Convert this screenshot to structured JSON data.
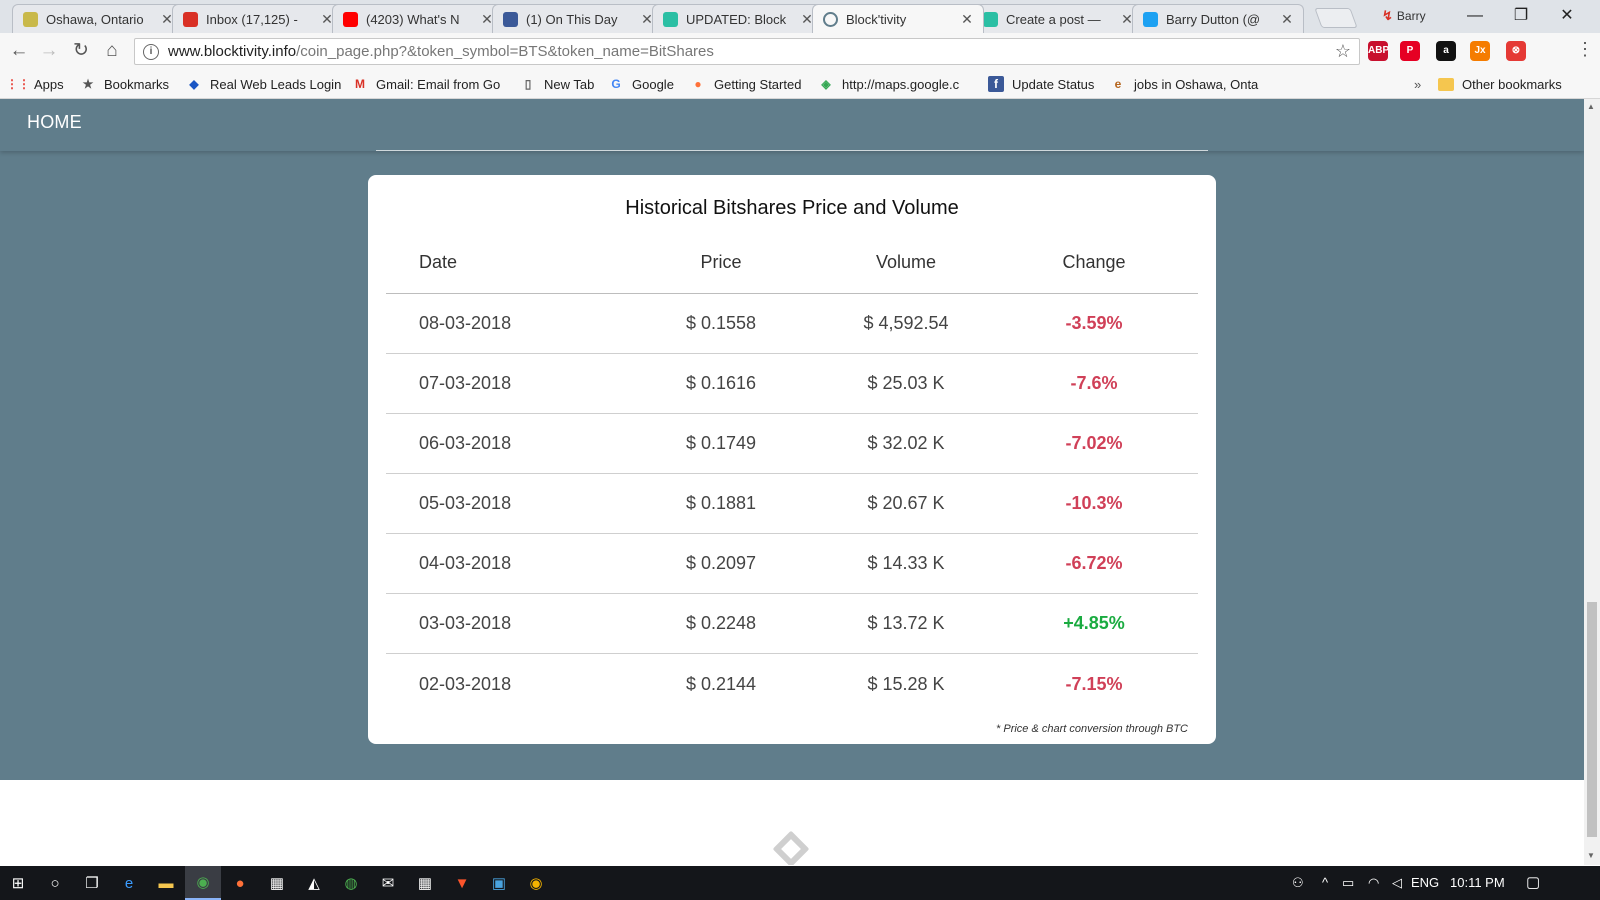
{
  "tabs": [
    {
      "title": "Oshawa, Ontario",
      "icon": "weather-icon",
      "color": "#c9b94a",
      "active": false
    },
    {
      "title": "Inbox (17,125) -",
      "icon": "gmail-icon",
      "color": "#d93025",
      "active": false
    },
    {
      "title": "(4203) What's N",
      "icon": "youtube-icon",
      "color": "#ff0000",
      "active": false
    },
    {
      "title": "(1) On This Day",
      "icon": "facebook-icon",
      "color": "#3b5998",
      "active": false
    },
    {
      "title": "UPDATED: Block",
      "icon": "blocktivity-icon",
      "color": "#2bbfa4",
      "active": false
    },
    {
      "title": "Block'tivity",
      "icon": "loading-icon",
      "color": "#607d8b",
      "active": true
    },
    {
      "title": "Create a post —",
      "icon": "blocktivity-icon",
      "color": "#2bbfa4",
      "active": false
    },
    {
      "title": "Barry Dutton (@",
      "icon": "twitter-icon",
      "color": "#1da1f2",
      "active": false
    }
  ],
  "profile_name": "Barry",
  "address": {
    "host": "www.blocktivity.info",
    "path": "/coin_page.php?&token_symbol=BTS&token_name=BitShares"
  },
  "extensions": [
    {
      "name": "adblock-icon",
      "label": "ABP",
      "badge": "1",
      "color": "#c8102e"
    },
    {
      "name": "pinterest-icon",
      "label": "P",
      "badge": "",
      "color": "#e60023"
    },
    {
      "name": "amazon-icon",
      "label": "a",
      "badge": "5",
      "color": "#111111"
    },
    {
      "name": "jx-icon",
      "label": "Jx",
      "badge": "",
      "color": "#f57c00"
    },
    {
      "name": "close-circle-icon",
      "label": "⊗",
      "badge": "",
      "color": "#e53935"
    }
  ],
  "bookmarks": [
    {
      "label": "Apps",
      "icon": "apps-grid-icon"
    },
    {
      "label": "Bookmarks",
      "icon": "star-icon"
    },
    {
      "label": "Real Web Leads Login",
      "icon": "leads-icon"
    },
    {
      "label": "Gmail: Email from Go",
      "icon": "gmail-icon"
    },
    {
      "label": "New Tab",
      "icon": "page-icon"
    },
    {
      "label": "Google",
      "icon": "google-icon"
    },
    {
      "label": "Getting Started",
      "icon": "firefox-icon"
    },
    {
      "label": "http://maps.google.c",
      "icon": "maps-icon"
    },
    {
      "label": "Update Status",
      "icon": "facebook-icon"
    },
    {
      "label": "jobs in Oshawa, Onta",
      "icon": "eluta-icon"
    }
  ],
  "overflow_label": "»",
  "other_bookmarks": "Other bookmarks",
  "nav": {
    "home": "HOME"
  },
  "table": {
    "title": "Historical Bitshares Price and Volume",
    "headers": [
      "Date",
      "Price",
      "Volume",
      "Change"
    ],
    "rows": [
      {
        "date": "08-03-2018",
        "price": "$ 0.1558",
        "volume": "$ 4,592.54",
        "change": "-3.59%",
        "trend": "neg"
      },
      {
        "date": "07-03-2018",
        "price": "$ 0.1616",
        "volume": "$ 25.03 K",
        "change": "-7.6%",
        "trend": "neg"
      },
      {
        "date": "06-03-2018",
        "price": "$ 0.1749",
        "volume": "$ 32.02 K",
        "change": "-7.02%",
        "trend": "neg"
      },
      {
        "date": "05-03-2018",
        "price": "$ 0.1881",
        "volume": "$ 20.67 K",
        "change": "-10.3%",
        "trend": "neg"
      },
      {
        "date": "04-03-2018",
        "price": "$ 0.2097",
        "volume": "$ 14.33 K",
        "change": "-6.72%",
        "trend": "neg"
      },
      {
        "date": "03-03-2018",
        "price": "$ 0.2248",
        "volume": "$ 13.72 K",
        "change": "+4.85%",
        "trend": "pos"
      },
      {
        "date": "02-03-2018",
        "price": "$ 0.2144",
        "volume": "$ 15.28 K",
        "change": "-7.15%",
        "trend": "neg"
      }
    ],
    "footnote": "* Price & chart conversion through BTC"
  },
  "colors": {
    "page_bg": "#607d8b",
    "negative": "#d04058",
    "positive": "#1aab40"
  },
  "taskbar": {
    "apps": [
      "windows-start-icon",
      "cortana-icon",
      "task-view-icon",
      "edge-icon",
      "file-explorer-icon",
      "chrome-icon",
      "firefox-icon",
      "calculator-icon",
      "photos-icon",
      "maps-icon",
      "mail-icon",
      "calculator-icon",
      "brave-icon",
      "app-icon",
      "chrome-canary-icon"
    ],
    "language": "ENG",
    "time": "10:11 PM"
  }
}
